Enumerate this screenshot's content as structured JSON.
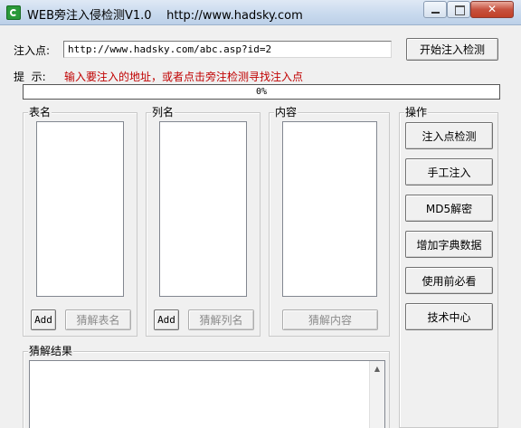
{
  "window": {
    "title": "WEB旁注入侵检测V1.0    http://www.hadsky.com"
  },
  "inject": {
    "label": "注入点:",
    "url_value": "http://www.hadsky.com/abc.asp?id=2",
    "start_button": "开始注入检测"
  },
  "hint": {
    "label": "提  示:",
    "text": "输入要注入的地址，或者点击旁注检测寻找注入点"
  },
  "progress": {
    "value_text": "0%",
    "value": 0
  },
  "groups": {
    "table": {
      "legend": "表名",
      "add_label": "Add",
      "guess_label": "猜解表名"
    },
    "column": {
      "legend": "列名",
      "add_label": "Add",
      "guess_label": "猜解列名"
    },
    "content": {
      "legend": "内容",
      "guess_label": "猜解内容"
    },
    "actions": {
      "legend": "操作",
      "buttons": [
        "注入点检测",
        "手工注入",
        "MD5解密",
        "增加字典数据",
        "使用前必看",
        "技术中心"
      ]
    },
    "result": {
      "legend": "猜解结果"
    }
  },
  "icons": {
    "app": "app-logo-icon",
    "minimize": "minimize-icon",
    "maximize": "maximize-icon",
    "close": "close-icon",
    "scroll_up": "scroll-up-arrow-icon"
  },
  "colors": {
    "hint": "#c00000",
    "window_bg": "#f0f0f0",
    "close_button": "#c7523f"
  }
}
